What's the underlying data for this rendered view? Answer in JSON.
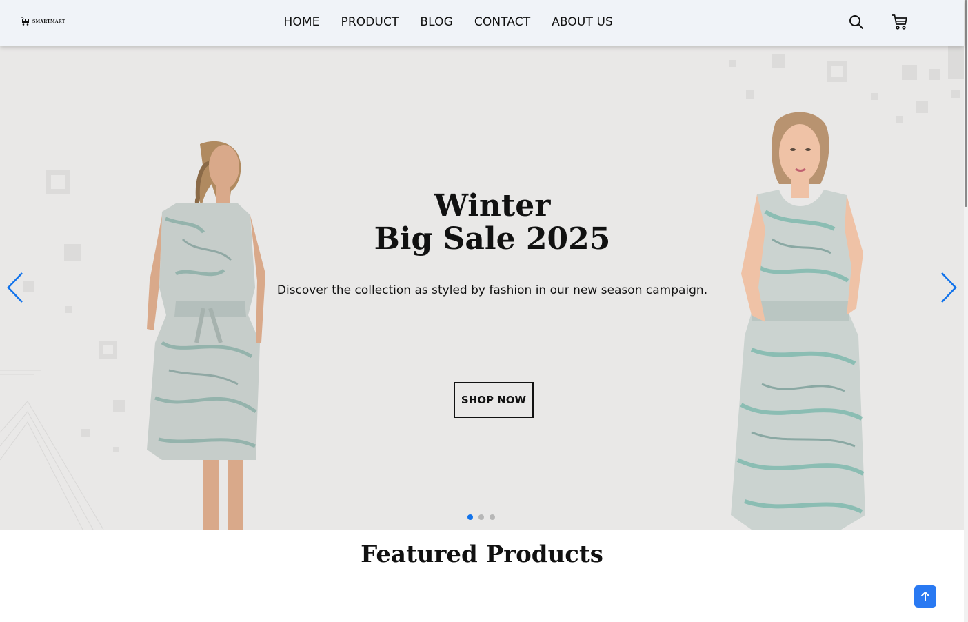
{
  "header": {
    "logo_text": "SMARTMART",
    "nav": [
      "HOME",
      "PRODUCT",
      "BLOG",
      "CONTACT",
      "ABOUT US"
    ],
    "icons": [
      "search-icon",
      "cart-icon"
    ]
  },
  "hero": {
    "title_line1": "Winter",
    "title_line2": "Big Sale 2025",
    "subtitle": "Discover the collection as styled by fashion in our new season campaign.",
    "cta": "SHOP NOW",
    "slides_total": 3,
    "active_slide": 1,
    "background_color": "#e9e8e7"
  },
  "featured": {
    "title": "Featured Products"
  },
  "colors": {
    "accent": "#2979f2",
    "active_dot": "#1273eb",
    "header_bg": "#f0f3f8"
  }
}
